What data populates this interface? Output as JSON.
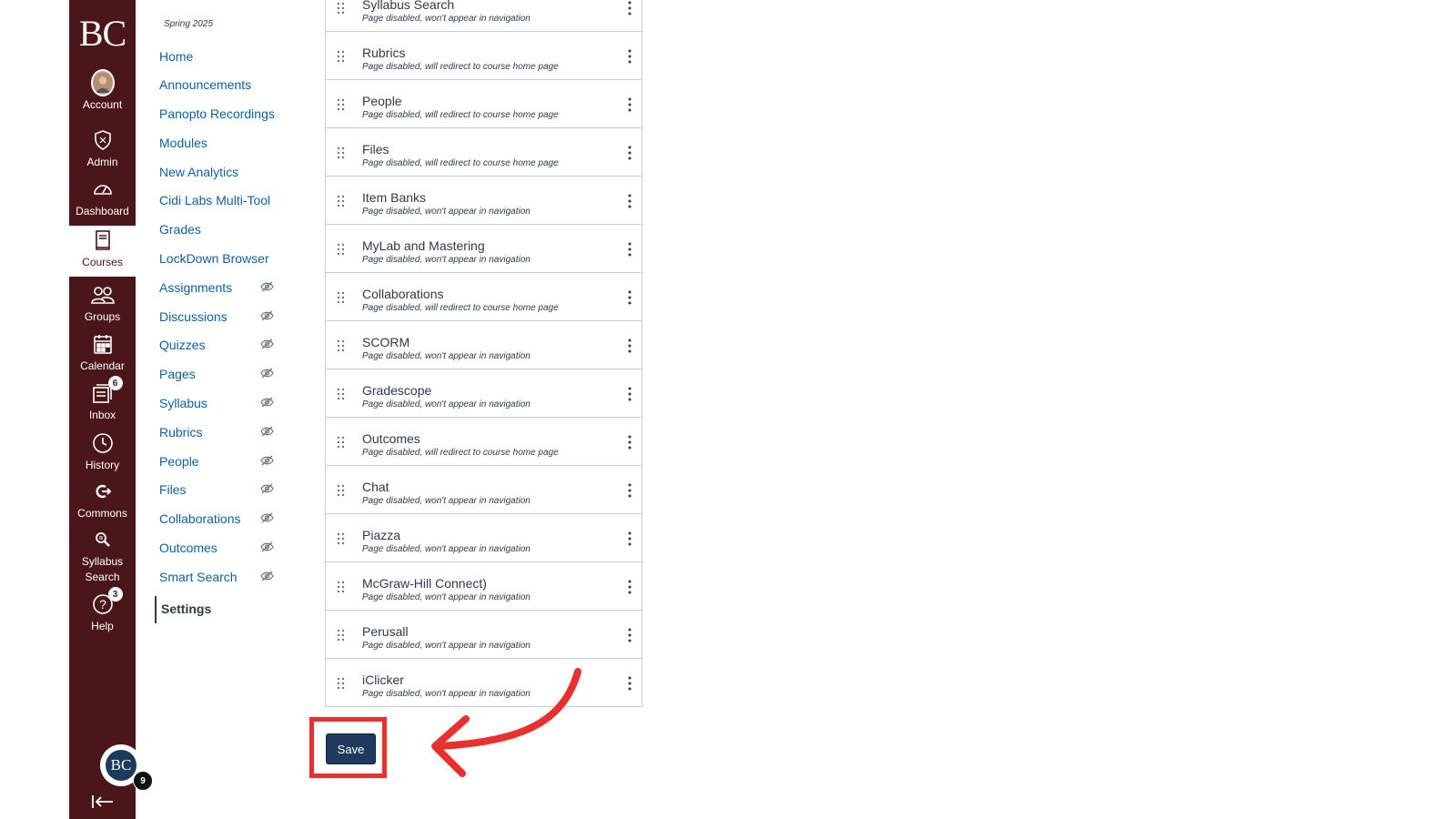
{
  "global_nav": {
    "logo": "BC",
    "items": [
      {
        "label": "Account",
        "icon": "account-avatar"
      },
      {
        "label": "Admin",
        "icon": "shield-icon"
      },
      {
        "label": "Dashboard",
        "icon": "dashboard-icon"
      },
      {
        "label": "Courses",
        "icon": "book-icon",
        "active": true
      },
      {
        "label": "Groups",
        "icon": "groups-icon"
      },
      {
        "label": "Calendar",
        "icon": "calendar-icon"
      },
      {
        "label": "Inbox",
        "icon": "inbox-icon",
        "badge": "6"
      },
      {
        "label": "History",
        "icon": "clock-icon"
      },
      {
        "label": "Commons",
        "icon": "commons-icon"
      },
      {
        "label": "Syllabus Search",
        "icon": "syllabus-search-icon"
      },
      {
        "label": "Help",
        "icon": "help-icon",
        "badge": "3"
      }
    ],
    "bottom_logo": "BC",
    "bottom_badge": "9"
  },
  "course_nav": {
    "term": "Spring 2025",
    "items": [
      {
        "label": "Home",
        "hidden": false
      },
      {
        "label": "Announcements",
        "hidden": false
      },
      {
        "label": "Panopto Recordings",
        "hidden": false
      },
      {
        "label": "Modules",
        "hidden": false
      },
      {
        "label": "New Analytics",
        "hidden": false
      },
      {
        "label": "Cidi Labs Multi-Tool",
        "hidden": false
      },
      {
        "label": "Grades",
        "hidden": false
      },
      {
        "label": "LockDown Browser",
        "hidden": false
      },
      {
        "label": "Assignments",
        "hidden": true
      },
      {
        "label": "Discussions",
        "hidden": true
      },
      {
        "label": "Quizzes",
        "hidden": true
      },
      {
        "label": "Pages",
        "hidden": true
      },
      {
        "label": "Syllabus",
        "hidden": true
      },
      {
        "label": "Rubrics",
        "hidden": true
      },
      {
        "label": "People",
        "hidden": true
      },
      {
        "label": "Files",
        "hidden": true
      },
      {
        "label": "Collaborations",
        "hidden": true
      },
      {
        "label": "Outcomes",
        "hidden": true
      },
      {
        "label": "Smart Search",
        "hidden": true
      }
    ],
    "active": "Settings"
  },
  "disabled_items": [
    {
      "title": "Syllabus Search",
      "status": "Page disabled, won't appear in navigation"
    },
    {
      "title": "Rubrics",
      "status": "Page disabled, will redirect to course home page"
    },
    {
      "title": "People",
      "status": "Page disabled, will redirect to course home page"
    },
    {
      "title": "Files",
      "status": "Page disabled, will redirect to course home page"
    },
    {
      "title": "Item Banks",
      "status": "Page disabled, won't appear in navigation"
    },
    {
      "title": "MyLab and Mastering",
      "status": "Page disabled, won't appear in navigation"
    },
    {
      "title": "Collaborations",
      "status": "Page disabled, will redirect to course home page"
    },
    {
      "title": "SCORM",
      "status": "Page disabled, won't appear in navigation"
    },
    {
      "title": "Gradescope",
      "status": "Page disabled, won't appear in navigation"
    },
    {
      "title": "Outcomes",
      "status": "Page disabled, will redirect to course home page"
    },
    {
      "title": "Chat",
      "status": "Page disabled, won't appear in navigation"
    },
    {
      "title": "Piazza",
      "status": "Page disabled, won't appear in navigation"
    },
    {
      "title": "McGraw-Hill Connect)",
      "status": "Page disabled, won't appear in navigation"
    },
    {
      "title": "Perusall",
      "status": "Page disabled, won't appear in navigation"
    },
    {
      "title": "iClicker",
      "status": "Page disabled, won't appear in navigation"
    }
  ],
  "save_label": "Save",
  "colors": {
    "nav_bg": "#4a1619",
    "link": "#0e5f9a",
    "save_bg": "#1f3a5c",
    "highlight": "#e8302e"
  }
}
